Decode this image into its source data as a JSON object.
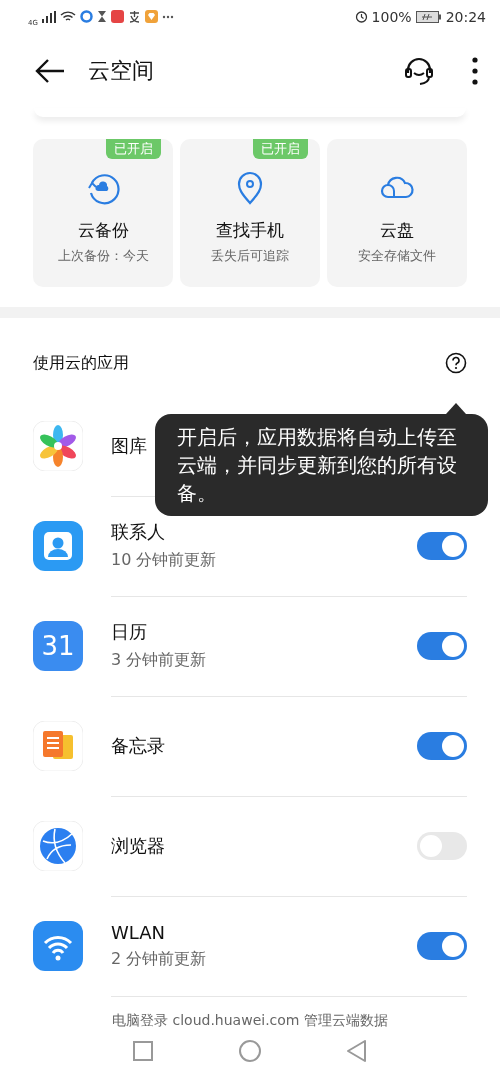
{
  "status_bar": {
    "network": "4G",
    "battery": "100%",
    "time": "20:24"
  },
  "header": {
    "title": "云空间"
  },
  "features": [
    {
      "kind": "backup",
      "title": "云备份",
      "subtitle": "上次备份：今天",
      "badge": "已开启"
    },
    {
      "kind": "find",
      "title": "查找手机",
      "subtitle": "丢失后可追踪",
      "badge": "已开启"
    },
    {
      "kind": "drive",
      "title": "云盘",
      "subtitle": "安全存储文件"
    }
  ],
  "apps_section": {
    "title": "使用云的应用",
    "tooltip": "开启后，应用数据将自动上传至云端，并同步更新到您的所有设备。"
  },
  "apps": [
    {
      "kind": "gallery",
      "name": "图库"
    },
    {
      "kind": "contacts",
      "name": "联系人",
      "subtitle": "10 分钟前更新",
      "on": true
    },
    {
      "kind": "calendar",
      "name": "日历",
      "subtitle": "3 分钟前更新",
      "on": true,
      "icon_text": "31"
    },
    {
      "kind": "notes",
      "name": "备忘录",
      "on": true
    },
    {
      "kind": "browser",
      "name": "浏览器",
      "on": false
    },
    {
      "kind": "wlan",
      "name": "WLAN",
      "subtitle": "2 分钟前更新",
      "on": true
    }
  ],
  "footer_link": "电脑登录 cloud.huawei.com 管理云端数据"
}
